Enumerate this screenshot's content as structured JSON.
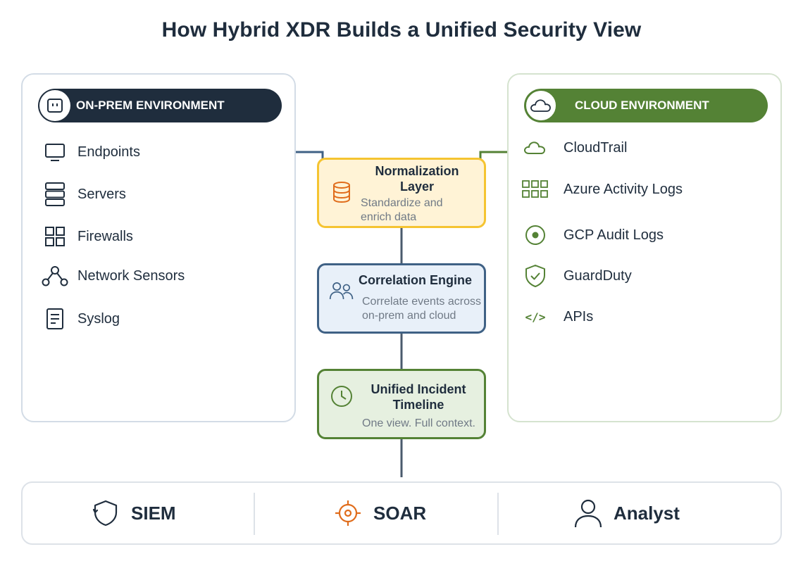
{
  "title": "How Hybrid XDR Builds a Unified Security View",
  "on_prem": {
    "header": "ON-PREM ENVIRONMENT",
    "header_icon": "server-box-icon",
    "items": [
      {
        "label": "Endpoints",
        "icon": "monitor-icon"
      },
      {
        "label": "Servers",
        "icon": "server-stack-icon"
      },
      {
        "label": "Firewalls",
        "icon": "grid-blocks-icon"
      },
      {
        "label": "Network Sensors",
        "icon": "network-nodes-icon"
      },
      {
        "label": "Syslog",
        "icon": "document-icon"
      }
    ]
  },
  "cloud": {
    "header": "CLOUD ENVIRONMENT",
    "header_icon": "cloud-icon",
    "items": [
      {
        "label": "CloudTrail",
        "icon": "cloud-icon"
      },
      {
        "label": "Azure Activity Logs",
        "icon": "tiles-icon"
      },
      {
        "label": "GCP Audit Logs",
        "icon": "target-dot-icon"
      },
      {
        "label": "GuardDuty",
        "icon": "shield-check-icon"
      },
      {
        "label": "APIs",
        "icon": "code-icon",
        "glyph": "</>"
      }
    ]
  },
  "pipeline": {
    "normalization": {
      "title": "Normalization Layer",
      "desc_line1": "Standardize and",
      "desc_line2": "enrich data",
      "icon": "database-icon"
    },
    "correlation": {
      "title": "Correlation Engine",
      "desc_line1": "Correlate events across",
      "desc_line2": "on-prem and cloud",
      "icon": "users-icon"
    },
    "timeline": {
      "title": "Unified Incident Timeline",
      "desc_line1": "One view. Full context.",
      "icon": "clock-icon"
    }
  },
  "outputs": [
    {
      "label": "SIEM",
      "icon": "shield-refresh-icon"
    },
    {
      "label": "SOAR",
      "icon": "crosshair-icon"
    },
    {
      "label": "Analyst",
      "icon": "person-icon"
    }
  ],
  "colors": {
    "navy": "#1f2d3d",
    "green": "#548235",
    "amber": "#f5c431",
    "orange": "#e06c1b",
    "steel": "#3f6185"
  }
}
